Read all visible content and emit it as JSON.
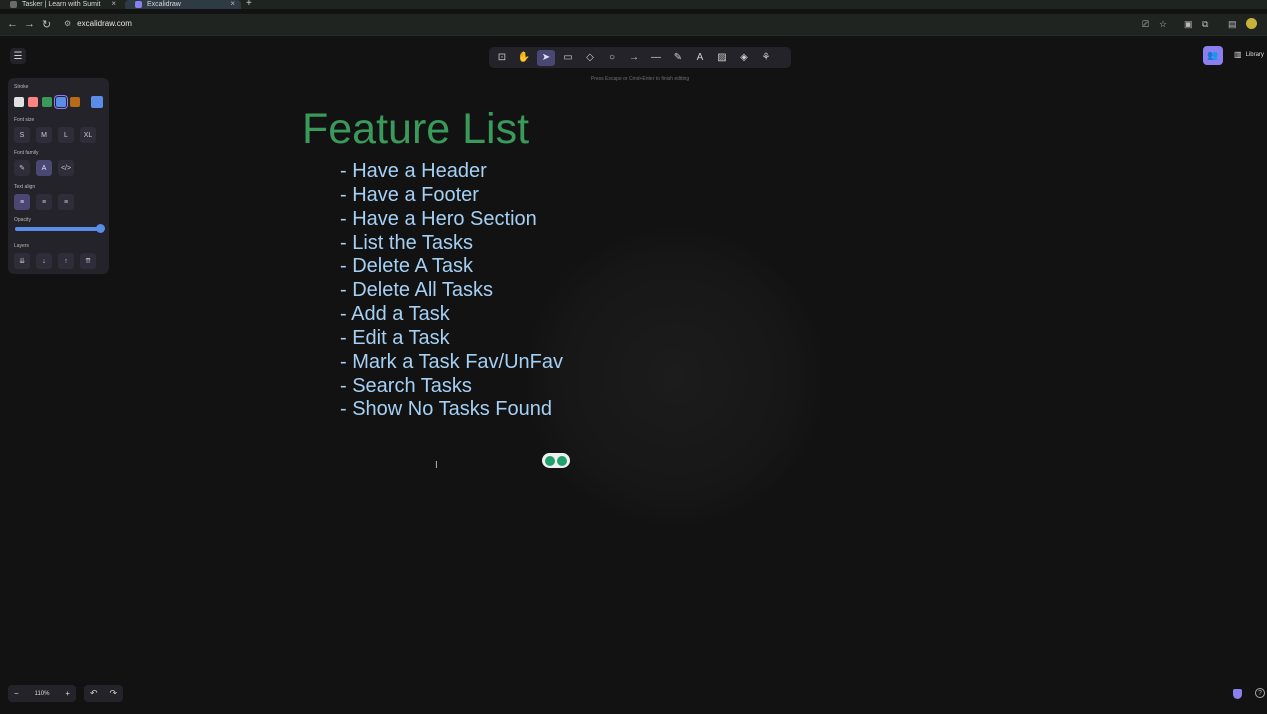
{
  "browser": {
    "tabs": [
      {
        "title": "Tasker | Learn with Sumit",
        "close": "×"
      },
      {
        "title": "Excalidraw",
        "close": "×"
      }
    ],
    "new_tab": "+",
    "url": "excalidraw.com",
    "nav": {
      "back": "←",
      "forward": "→",
      "reload": "↻",
      "site_info": "⚙"
    },
    "right_icons": {
      "install": "⎚",
      "bookmark": "☆",
      "ext1": "▣",
      "ext2": "⧉",
      "sidebar": "▤"
    }
  },
  "app": {
    "menu_icon": "☰",
    "toolbar": [
      {
        "icon": "lock-icon",
        "glyph": "⊡"
      },
      {
        "icon": "hand-icon",
        "glyph": "✋"
      },
      {
        "icon": "selection-icon",
        "glyph": "➤",
        "active": true
      },
      {
        "icon": "rectangle-icon",
        "glyph": "▭"
      },
      {
        "icon": "diamond-icon",
        "glyph": "◇"
      },
      {
        "icon": "ellipse-icon",
        "glyph": "○"
      },
      {
        "icon": "arrow-icon",
        "glyph": "→"
      },
      {
        "icon": "line-icon",
        "glyph": "—"
      },
      {
        "icon": "pencil-icon",
        "glyph": "✎"
      },
      {
        "icon": "text-icon",
        "glyph": "A"
      },
      {
        "icon": "image-icon",
        "glyph": "▨"
      },
      {
        "icon": "eraser-icon",
        "glyph": "◈"
      },
      {
        "icon": "extra-tools-icon",
        "glyph": "⚘"
      }
    ],
    "hint": "Press Escape or Cmd+Enter to finish editing",
    "collab_icon": "👥",
    "library_label": "Library",
    "library_icon": "▥"
  },
  "properties": {
    "stroke_label": "Stroke",
    "stroke_colors": [
      "#e0e0e0",
      "#ff8383",
      "#3a9a5b",
      "#5a8de8",
      "#b86a17"
    ],
    "stroke_selected_index": 3,
    "current_stroke": "#5a8de8",
    "font_size_label": "Font size",
    "font_sizes": [
      "S",
      "M",
      "L",
      "XL"
    ],
    "font_family_label": "Font family",
    "font_families": [
      "✎",
      "A",
      "</>"
    ],
    "font_family_selected_index": 1,
    "text_align_label": "Text align",
    "text_aligns": [
      "≡",
      "≡",
      "≡"
    ],
    "text_align_selected_index": 0,
    "opacity_label": "Opacity",
    "opacity_value": 100,
    "layers_label": "Layers",
    "layers": [
      "⇊",
      "↓",
      "↑",
      "⇈"
    ]
  },
  "canvas": {
    "title": "Feature List",
    "title_color": "#3a9a5b",
    "text_color": "#a5d0f4",
    "features": [
      "- Have a Header",
      "- Have a Footer",
      "- Have a Hero Section",
      "- List the Tasks",
      "- Delete A Task",
      "- Delete All Tasks",
      "- Add a Task",
      "- Edit a Task",
      "- Mark a Task Fav/UnFav",
      "- Search Tasks",
      "- Show No Tasks Found"
    ]
  },
  "footer": {
    "zoom_out": "−",
    "zoom_level": "110%",
    "zoom_in": "+",
    "undo": "↶",
    "redo": "↷",
    "help": "?"
  }
}
